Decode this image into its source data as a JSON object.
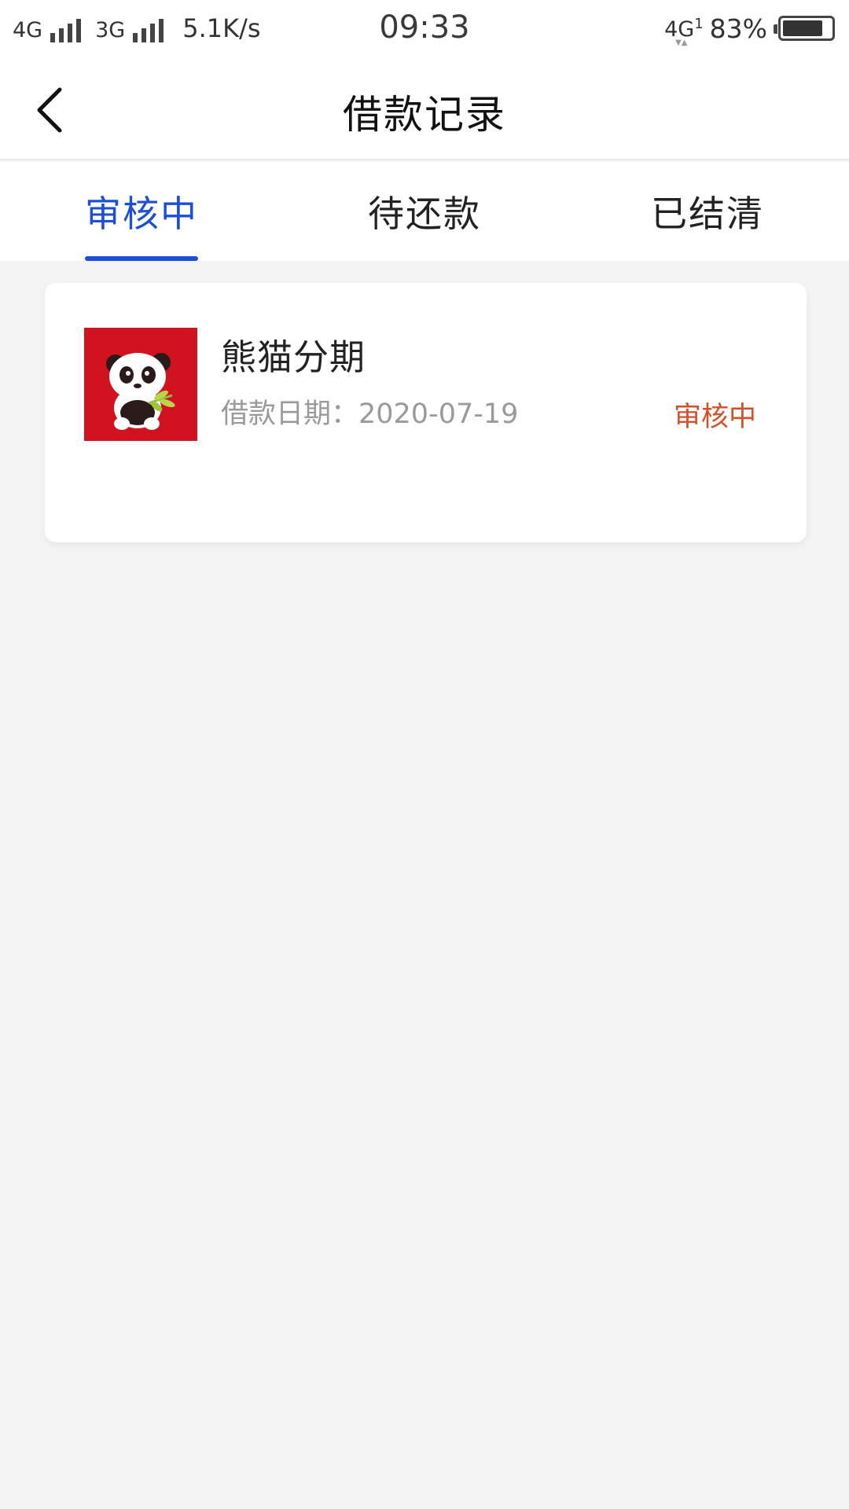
{
  "status_bar": {
    "net1": "4G",
    "net2": "3G",
    "speed": "5.1K/s",
    "time": "09:33",
    "net_right": "4G",
    "net_right_sub": "1",
    "battery": "83%",
    "battery_level": 0.83
  },
  "nav": {
    "title": "借款记录"
  },
  "tabs": [
    {
      "label": "审核中",
      "active": true
    },
    {
      "label": "待还款",
      "active": false
    },
    {
      "label": "已结清",
      "active": false
    }
  ],
  "colors": {
    "accent": "#1c4ed8",
    "status_pending": "#d2502a",
    "logo_bg": "#d0131f"
  },
  "records": [
    {
      "name": "熊猫分期",
      "date_label": "借款日期：2020-07-19",
      "status": "审核中",
      "logo_icon": "panda-logo-icon"
    }
  ]
}
